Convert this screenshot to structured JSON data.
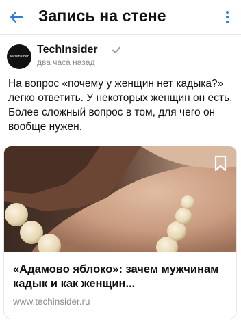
{
  "header": {
    "title": "Запись на стене",
    "back_icon": "arrow-left-icon",
    "menu_icon": "more-vertical-icon"
  },
  "post": {
    "author": {
      "name": "TechInsider",
      "avatar_text": "TechInsider",
      "verified_icon": "checkmark-icon"
    },
    "time": "два часа назад",
    "text": "На вопрос «почему у женщин нет кадыка?» легко ответить. У некоторых женщин он есть. Более сложный вопрос в том, для чего он вообще нужен."
  },
  "card": {
    "title": "«Адамово яблоко»: зачем мужчинам кадык и как женщин...",
    "domain": "www.techinsider.ru",
    "bookmark_icon": "bookmark-icon"
  },
  "colors": {
    "accent": "#2c7bd6",
    "text_primary": "#111111",
    "text_secondary": "#8a8f96",
    "verified": "#8fa0b3"
  }
}
